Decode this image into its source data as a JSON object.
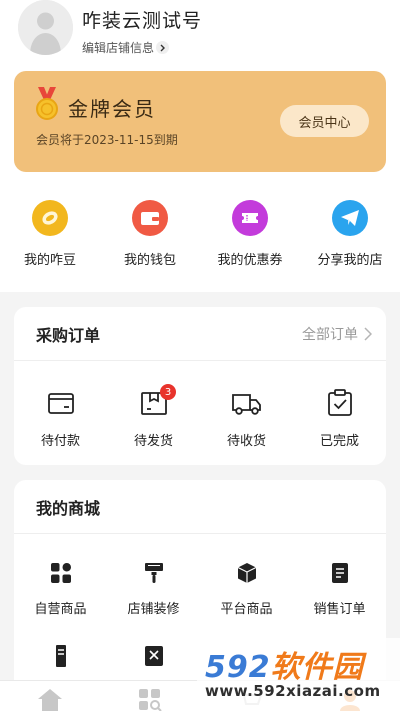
{
  "profile": {
    "shop_name": "咋装云测试号",
    "edit_label": "编辑店铺信息"
  },
  "member": {
    "title": "金牌会员",
    "expire_text": "会员将于2023-11-15到期",
    "center_button": "会员中心",
    "card_color": "#f1c07a"
  },
  "quick_links": [
    {
      "label": "我的咋豆",
      "icon": "bean-icon",
      "color": "#f2b71e"
    },
    {
      "label": "我的钱包",
      "icon": "wallet-icon",
      "color": "#f05a44"
    },
    {
      "label": "我的优惠券",
      "icon": "coupon-icon",
      "color": "#c33bdb"
    },
    {
      "label": "分享我的店",
      "icon": "share-plane-icon",
      "color": "#2aa4ee"
    }
  ],
  "purchase_orders": {
    "title": "采购订单",
    "all_label": "全部订单",
    "items": [
      {
        "label": "待付款",
        "icon": "wallet-outline-icon"
      },
      {
        "label": "待发货",
        "icon": "box-outline-icon",
        "badge": "3"
      },
      {
        "label": "待收货",
        "icon": "truck-outline-icon"
      },
      {
        "label": "已完成",
        "icon": "clipboard-check-icon"
      }
    ]
  },
  "my_mall": {
    "title": "我的商城",
    "items": [
      {
        "label": "自营商品",
        "icon": "grid-tiles-icon"
      },
      {
        "label": "店铺装修",
        "icon": "paint-brush-icon"
      },
      {
        "label": "平台商品",
        "icon": "cube-icon"
      },
      {
        "label": "销售订单",
        "icon": "document-list-icon"
      }
    ]
  },
  "bottom_nav": [
    {
      "icon": "home-icon"
    },
    {
      "icon": "category-search-icon"
    },
    {
      "icon": "cart-icon"
    },
    {
      "icon": "profile-icon"
    }
  ],
  "watermark": {
    "brand": "592软件园",
    "url": "www.592xiazai.com"
  }
}
